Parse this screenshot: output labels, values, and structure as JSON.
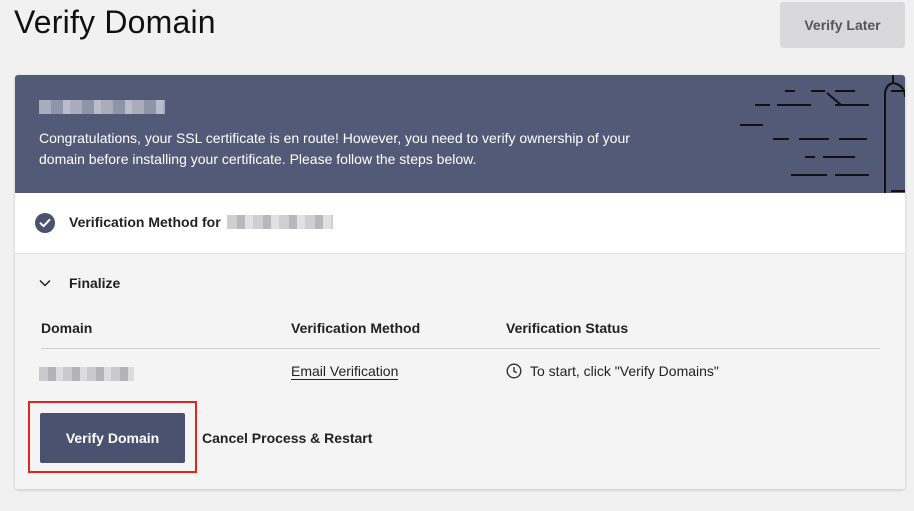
{
  "page": {
    "title": "Verify Domain",
    "verify_later_label": "Verify Later"
  },
  "banner": {
    "message": "Congratulations, your SSL certificate is en route! However, you need to verify ownership of your domain before installing your certificate. Please follow the steps below.",
    "background": "#525a78"
  },
  "method_row": {
    "label": "Verification Method for"
  },
  "finalize": {
    "label": "Finalize",
    "columns": [
      "Domain",
      "Verification Method",
      "Verification Status"
    ],
    "rows": [
      {
        "verification_method": "Email Verification",
        "status": "To start, click \"Verify Domains\""
      }
    ],
    "verify_domain_label": "Verify Domain",
    "cancel_label": "Cancel Process & Restart"
  },
  "icons": {
    "check": "check-circle-icon",
    "chevron": "chevron-down-icon",
    "clock": "clock-icon"
  },
  "colors": {
    "accent": "#4a526f",
    "highlight": "#e2241f"
  }
}
